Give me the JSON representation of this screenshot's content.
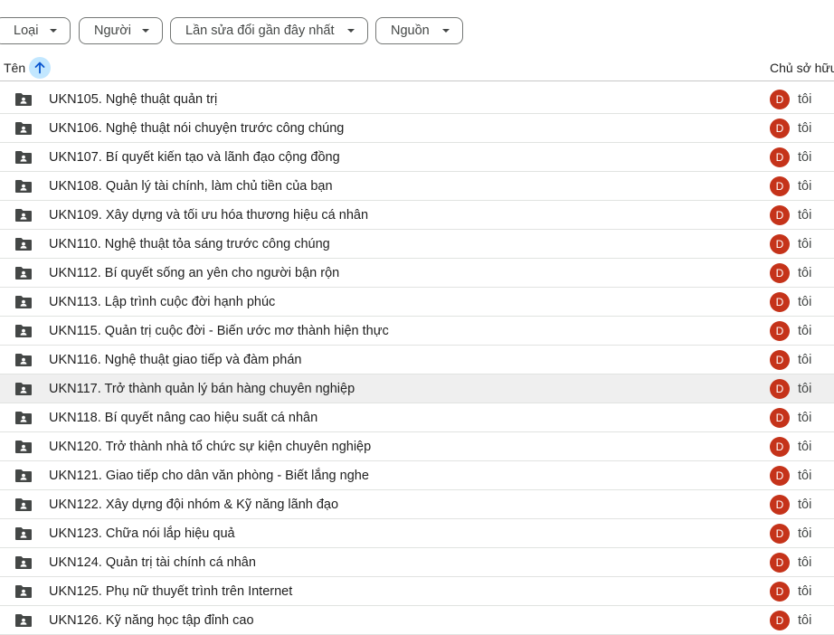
{
  "filters": [
    {
      "label": "Loại"
    },
    {
      "label": "Người"
    },
    {
      "label": "Lần sửa đổi gần đây nhất"
    },
    {
      "label": "Nguồn"
    }
  ],
  "header": {
    "name": "Tên",
    "owner": "Chủ sở hữu"
  },
  "rows": [
    {
      "name": "UKN105. Nghệ thuật quản trị",
      "avatar": "D",
      "owner": "tôi"
    },
    {
      "name": "UKN106. Nghệ thuật nói chuyện trước công chúng",
      "avatar": "D",
      "owner": "tôi"
    },
    {
      "name": "UKN107. Bí quyết kiến tạo và lãnh đạo cộng đồng",
      "avatar": "D",
      "owner": "tôi"
    },
    {
      "name": "UKN108. Quản lý tài chính, làm chủ tiền của bạn",
      "avatar": "D",
      "owner": "tôi"
    },
    {
      "name": "UKN109. Xây dựng và tối ưu hóa thương hiệu cá nhân",
      "avatar": "D",
      "owner": "tôi"
    },
    {
      "name": "UKN110. Nghệ thuật tỏa sáng trước công chúng",
      "avatar": "D",
      "owner": "tôi"
    },
    {
      "name": "UKN112. Bí quyết sống an yên cho người bận rộn",
      "avatar": "D",
      "owner": "tôi"
    },
    {
      "name": "UKN113. Lập trình cuộc đời hạnh phúc",
      "avatar": "D",
      "owner": "tôi"
    },
    {
      "name": "UKN115. Quản trị cuộc đời - Biến ước mơ thành hiện thực",
      "avatar": "D",
      "owner": "tôi"
    },
    {
      "name": "UKN116. Nghệ thuật giao tiếp và đàm phán",
      "avatar": "D",
      "owner": "tôi"
    },
    {
      "name": "UKN117. Trở thành quản lý bán hàng chuyên nghiệp",
      "avatar": "D",
      "owner": "tôi"
    },
    {
      "name": "UKN118. Bí quyết nâng cao hiệu suất cá nhân",
      "avatar": "D",
      "owner": "tôi"
    },
    {
      "name": "UKN120. Trở thành nhà tổ chức sự kiện chuyên nghiệp",
      "avatar": "D",
      "owner": "tôi"
    },
    {
      "name": "UKN121. Giao tiếp cho dân văn phòng - Biết lắng nghe",
      "avatar": "D",
      "owner": "tôi"
    },
    {
      "name": "UKN122. Xây dựng đội nhóm & Kỹ năng lãnh đạo",
      "avatar": "D",
      "owner": "tôi"
    },
    {
      "name": "UKN123. Chữa nói lắp hiệu quả",
      "avatar": "D",
      "owner": "tôi"
    },
    {
      "name": "UKN124. Quản trị tài chính cá nhân",
      "avatar": "D",
      "owner": "tôi"
    },
    {
      "name": "UKN125. Phụ nữ thuyết trình trên Internet",
      "avatar": "D",
      "owner": "tôi"
    },
    {
      "name": "UKN126. Kỹ năng học tập đỉnh cao",
      "avatar": "D",
      "owner": "tôi"
    }
  ]
}
